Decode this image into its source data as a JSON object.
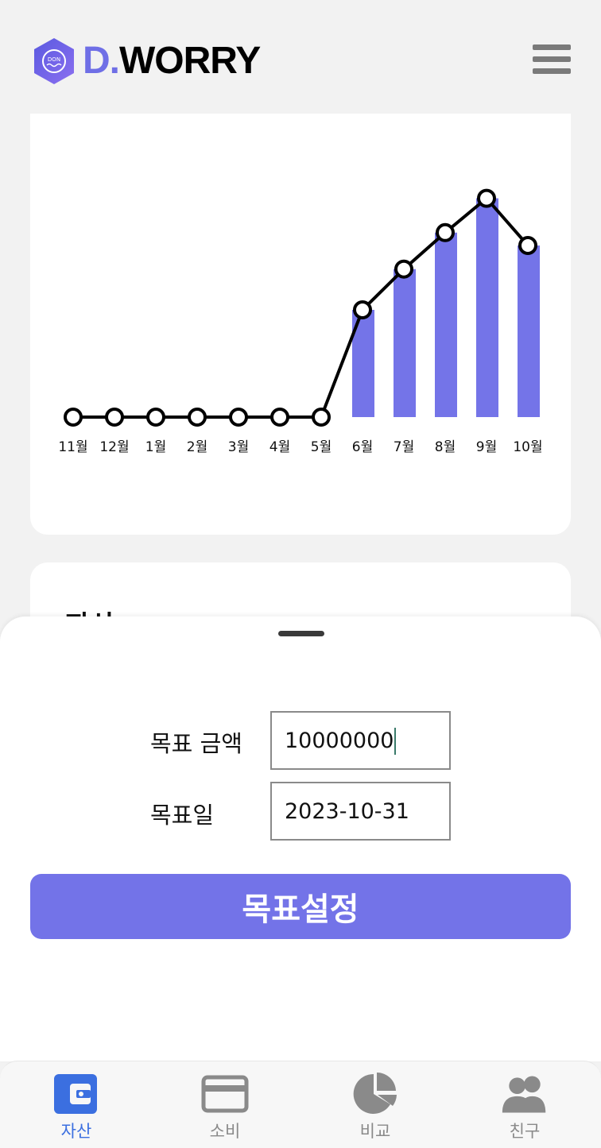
{
  "header": {
    "logo_badge_text": "DON",
    "logo_prefix": "D.",
    "logo_name": "WORRY",
    "menu_icon": "hamburger-menu-icon"
  },
  "chart_data": {
    "type": "bar+line",
    "categories": [
      "11월",
      "12월",
      "1월",
      "2월",
      "3월",
      "4월",
      "5월",
      "6월",
      "7월",
      "8월",
      "9월",
      "10월"
    ],
    "values": [
      0,
      0,
      0,
      0,
      0,
      0,
      0,
      50,
      69,
      86,
      102,
      80
    ],
    "ylim": [
      0,
      110
    ],
    "bar_color": "#7474e8",
    "line_color": "#000000",
    "grid": false,
    "legend": "none"
  },
  "card2": {
    "title_partial": "자산",
    "edge_partial": "…"
  },
  "goal_form": {
    "amount_label": "목표 금액",
    "amount_value": "10000000",
    "date_label": "목표일",
    "date_value": "2023-10-31",
    "submit_label": "목표설정"
  },
  "bottom_nav": {
    "items": [
      {
        "label": "자산",
        "icon": "wallet-icon",
        "active": true
      },
      {
        "label": "소비",
        "icon": "credit-card-icon",
        "active": false
      },
      {
        "label": "비교",
        "icon": "pie-chart-icon",
        "active": false
      },
      {
        "label": "친구",
        "icon": "friends-icon",
        "active": false
      }
    ]
  },
  "colors": {
    "accent": "#7373e8",
    "active_nav": "#3b6fe0",
    "inactive_nav": "#8a8a8a",
    "background": "#f2f2f2"
  }
}
